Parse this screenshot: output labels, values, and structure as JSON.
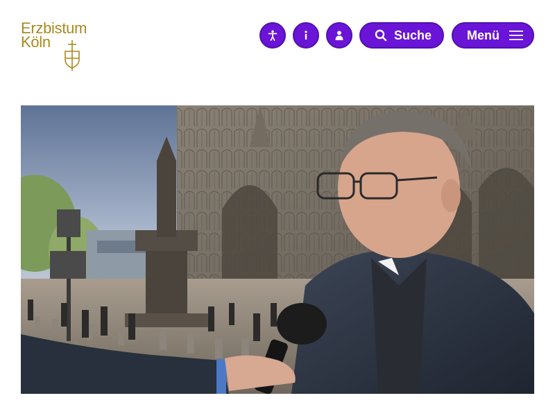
{
  "logo": {
    "line1": "Erzbistum",
    "line2": "Köln",
    "emblem": "cross-shield-icon",
    "color": "#a8891f"
  },
  "nav": {
    "accessibility_icon": "accessibility-icon",
    "info_icon": "info-icon",
    "account_icon": "user-icon",
    "search_label": "Suche",
    "search_icon": "search-icon",
    "menu_label": "Menü",
    "menu_icon": "hamburger-icon",
    "accent": "#6a14d8"
  },
  "hero": {
    "image": "photo-cardinal-interview-cologne-cathedral"
  }
}
